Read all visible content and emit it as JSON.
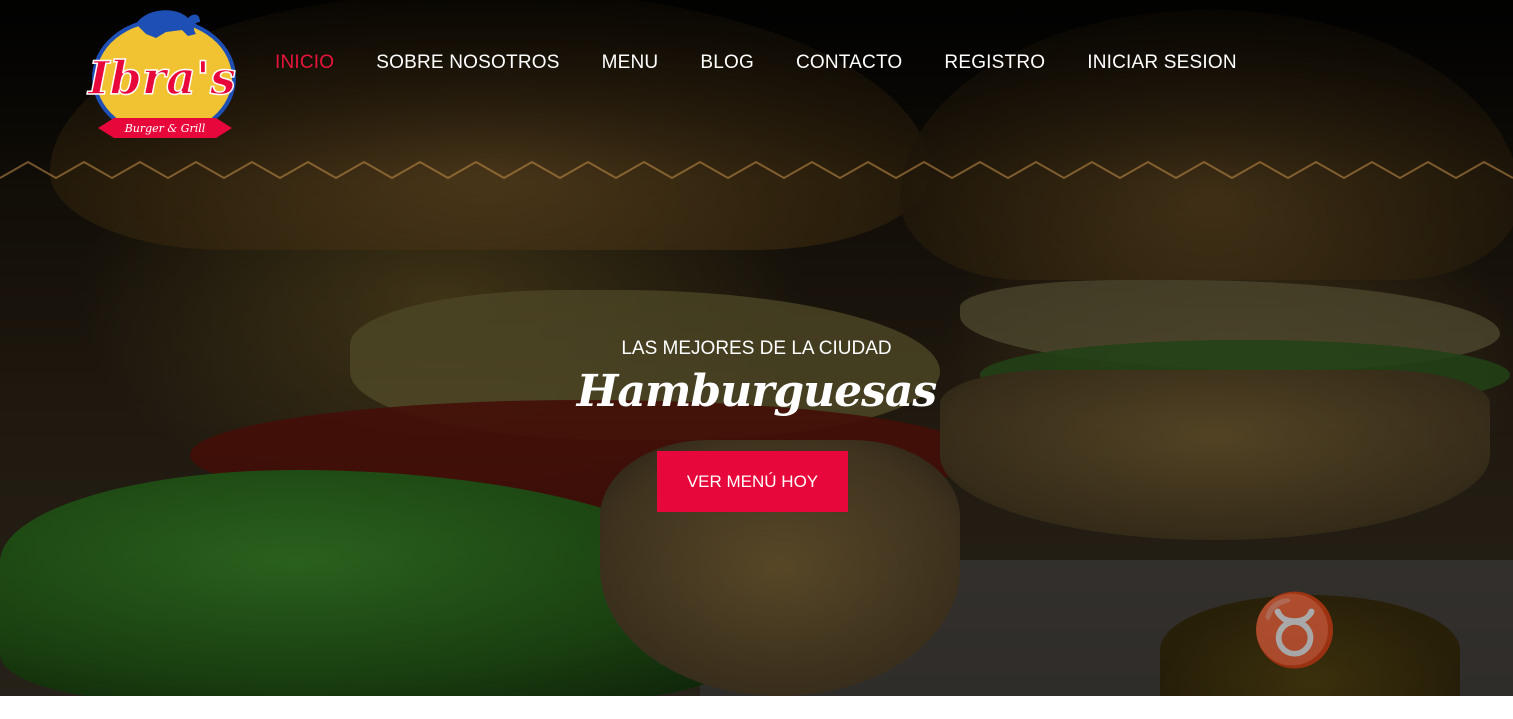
{
  "brand": {
    "logo_text": "Ibra's",
    "logo_tagline": "Burger & Grill",
    "colors": {
      "red": "#e8073a",
      "blue": "#1e4fb4",
      "yellow": "#f1c232"
    }
  },
  "nav": {
    "items": [
      {
        "label": "INICIO",
        "active": true
      },
      {
        "label": "SOBRE NOSOTROS",
        "active": false
      },
      {
        "label": "MENU",
        "active": false
      },
      {
        "label": "BLOG",
        "active": false
      },
      {
        "label": "CONTACTO",
        "active": false
      },
      {
        "label": "REGISTRO",
        "active": false
      },
      {
        "label": "INICIAR SESION",
        "active": false
      }
    ],
    "active_color": "#e8143c"
  },
  "hero": {
    "subtitle": "LAS MEJORES DE LA CIUDAD",
    "title": "Hamburguesas",
    "cta_label": "VER MENÚ HOY",
    "background_icon": "bull-icon"
  }
}
